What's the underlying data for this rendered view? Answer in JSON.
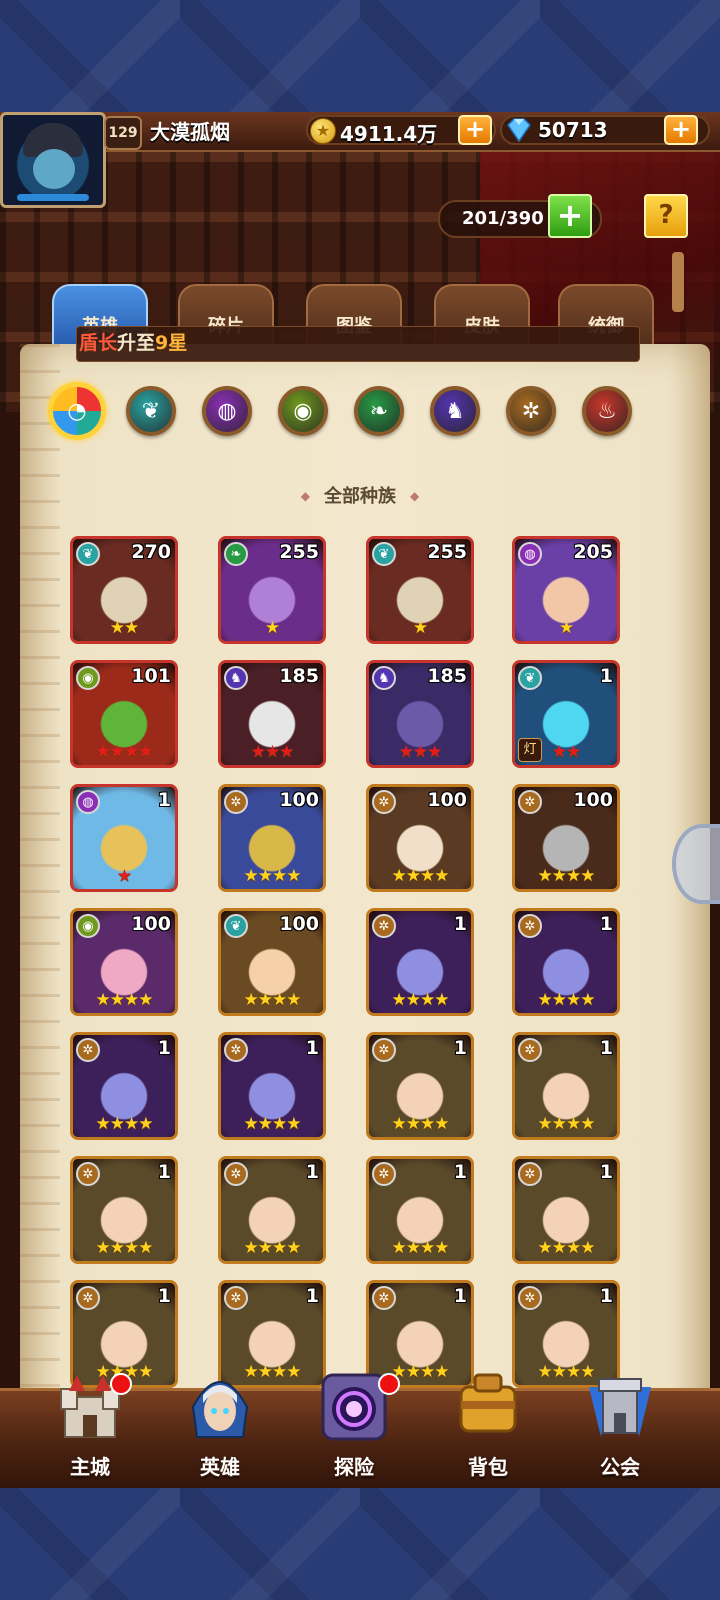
{
  "player": {
    "level": "129",
    "name": "大漠孤烟",
    "gold": "4911.4万",
    "gems": "50713"
  },
  "capacity": "201/390",
  "tabs": [
    {
      "label": "英雄",
      "active": true
    },
    {
      "label": "碎片"
    },
    {
      "label": "图鉴"
    },
    {
      "label": "皮肤"
    },
    {
      "label": "统御"
    }
  ],
  "notice": {
    "a": "盾长",
    "b": "升至",
    "c": "9星"
  },
  "races": [
    {
      "name": "all",
      "color": "#e9ecef",
      "selected": true
    },
    {
      "name": "forest",
      "color": "#2aa2a2"
    },
    {
      "name": "shadow",
      "color": "#8a2fb5"
    },
    {
      "name": "fortress",
      "color": "#6f9a1e"
    },
    {
      "name": "abyss",
      "color": "#279a44"
    },
    {
      "name": "dark",
      "color": "#5534b0"
    },
    {
      "name": "light",
      "color": "#a86a1f"
    },
    {
      "name": "fire",
      "color": "#c8362a"
    }
  ],
  "race_title": "全部种族",
  "heroes": [
    {
      "level": "270",
      "stars": 2,
      "star_color": "y",
      "faction": "forest",
      "art": "#6a2b22",
      "face": "#e0d3b5",
      "frame": "red"
    },
    {
      "level": "255",
      "stars": 1,
      "star_color": "y",
      "faction": "abyss",
      "art": "#6b2d8a",
      "face": "#b07fd6",
      "frame": "red"
    },
    {
      "level": "255",
      "stars": 1,
      "star_color": "y",
      "faction": "forest",
      "art": "#6a2b22",
      "face": "#e0d3b5",
      "frame": "red"
    },
    {
      "level": "205",
      "stars": 1,
      "star_color": "y",
      "faction": "shadow",
      "art": "#6a3fa6",
      "face": "#f2c7a8",
      "frame": "red"
    },
    {
      "level": "101",
      "stars": 4,
      "star_color": "r",
      "faction": "fortress",
      "art": "#9b2a1a",
      "face": "#5fb53a",
      "frame": "red"
    },
    {
      "level": "185",
      "stars": 3,
      "star_color": "r",
      "faction": "dark",
      "art": "#4a1f25",
      "face": "#e6e6e6",
      "frame": "red"
    },
    {
      "level": "185",
      "stars": 3,
      "star_color": "r",
      "faction": "dark",
      "art": "#3a2b66",
      "face": "#6b5aa8",
      "frame": "red"
    },
    {
      "level": "1",
      "stars": 2,
      "star_color": "r",
      "faction": "forest",
      "art": "#1f4f7a",
      "face": "#4fd6f0",
      "frame": "red",
      "tag": "灯"
    },
    {
      "level": "1",
      "stars": 1,
      "star_color": "r",
      "faction": "shadow",
      "art": "#6fb9e6",
      "face": "#e7c25a",
      "frame": "red"
    },
    {
      "level": "100",
      "stars": 4,
      "star_color": "y",
      "faction": "light",
      "art": "#3a4a9a",
      "face": "#d9b84a",
      "frame": "gold"
    },
    {
      "level": "100",
      "stars": 4,
      "star_color": "y",
      "faction": "light",
      "art": "#5a3a22",
      "face": "#f1dfc9",
      "frame": "gold"
    },
    {
      "level": "100",
      "stars": 4,
      "star_color": "y",
      "faction": "light",
      "art": "#4a2a1a",
      "face": "#b5b5b5",
      "frame": "gold"
    },
    {
      "level": "100",
      "stars": 4,
      "star_color": "y",
      "faction": "fortress",
      "art": "#5a2a6a",
      "face": "#f0a9c4",
      "frame": "gold"
    },
    {
      "level": "100",
      "stars": 4,
      "star_color": "y",
      "faction": "forest",
      "art": "#6a4a22",
      "face": "#f6d0a8",
      "frame": "gold"
    },
    {
      "level": "1",
      "stars": 4,
      "star_color": "y",
      "faction": "light",
      "art": "#3d1f5a",
      "face": "#8e8fe0",
      "frame": "gold"
    },
    {
      "level": "1",
      "stars": 4,
      "star_color": "y",
      "faction": "light",
      "art": "#3d1f5a",
      "face": "#8e8fe0",
      "frame": "gold"
    },
    {
      "level": "1",
      "stars": 4,
      "star_color": "y",
      "faction": "light",
      "art": "#3d1f5a",
      "face": "#8e8fe0",
      "frame": "gold"
    },
    {
      "level": "1",
      "stars": 4,
      "star_color": "y",
      "faction": "light",
      "art": "#3d1f5a",
      "face": "#8e8fe0",
      "frame": "gold"
    },
    {
      "level": "1",
      "stars": 4,
      "star_color": "y",
      "faction": "light",
      "art": "#5a4a2a",
      "face": "#f3d2b8",
      "frame": "gold"
    },
    {
      "level": "1",
      "stars": 4,
      "star_color": "y",
      "faction": "light",
      "art": "#5a4a2a",
      "face": "#f3d2b8",
      "frame": "gold"
    },
    {
      "level": "1",
      "stars": 4,
      "star_color": "y",
      "faction": "light",
      "art": "#5a4a2a",
      "face": "#f3d2b8",
      "frame": "gold"
    },
    {
      "level": "1",
      "stars": 4,
      "star_color": "y",
      "faction": "light",
      "art": "#5a4a2a",
      "face": "#f3d2b8",
      "frame": "gold"
    },
    {
      "level": "1",
      "stars": 4,
      "star_color": "y",
      "faction": "light",
      "art": "#5a4a2a",
      "face": "#f3d2b8",
      "frame": "gold"
    },
    {
      "level": "1",
      "stars": 4,
      "star_color": "y",
      "faction": "light",
      "art": "#5a4a2a",
      "face": "#f3d2b8",
      "frame": "gold"
    },
    {
      "level": "1",
      "stars": 4,
      "star_color": "y",
      "faction": "light",
      "art": "#5a4a2a",
      "face": "#f3d2b8",
      "frame": "gold"
    },
    {
      "level": "1",
      "stars": 4,
      "star_color": "y",
      "faction": "light",
      "art": "#5a4a2a",
      "face": "#f3d2b8",
      "frame": "gold"
    },
    {
      "level": "1",
      "stars": 4,
      "star_color": "y",
      "faction": "light",
      "art": "#5a4a2a",
      "face": "#f3d2b8",
      "frame": "gold"
    },
    {
      "level": "1",
      "stars": 4,
      "star_color": "y",
      "faction": "light",
      "art": "#5a4a2a",
      "face": "#f3d2b8",
      "frame": "gold"
    }
  ],
  "nav": [
    {
      "label": "主城",
      "icon": "castle-icon",
      "badge": true
    },
    {
      "label": "英雄",
      "icon": "hero-icon"
    },
    {
      "label": "探险",
      "icon": "portal-icon",
      "badge": true
    },
    {
      "label": "背包",
      "icon": "bag-icon"
    },
    {
      "label": "公会",
      "icon": "guild-icon"
    }
  ]
}
